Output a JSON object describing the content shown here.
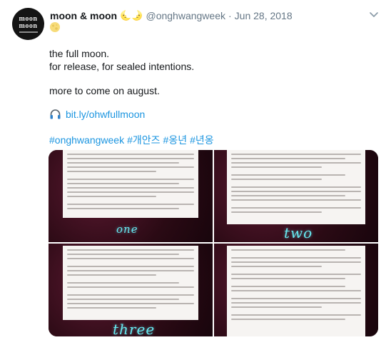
{
  "author": {
    "display_name": "moon & moon",
    "name_emoji": "🌜🌛",
    "handle": "@onghwangweek",
    "separator": "·",
    "date": "Jun 28, 2018",
    "avatar_line1": "moon",
    "avatar_line2": "moon"
  },
  "tweet": {
    "emoji": "🌕",
    "line1": "the full moon.",
    "line2": "for release, for sealed intentions.",
    "line3": "more to come on august.",
    "link_text": "bit.ly/ohwfullmoon",
    "hashtags": [
      "#onghwangweek",
      "#개안즈",
      "#옹년",
      "#년옹"
    ]
  },
  "media": {
    "captions": [
      "one",
      "two",
      "three"
    ]
  },
  "colors": {
    "link": "#1b95e0",
    "muted": "#657786",
    "caption": "#67e8f0"
  }
}
